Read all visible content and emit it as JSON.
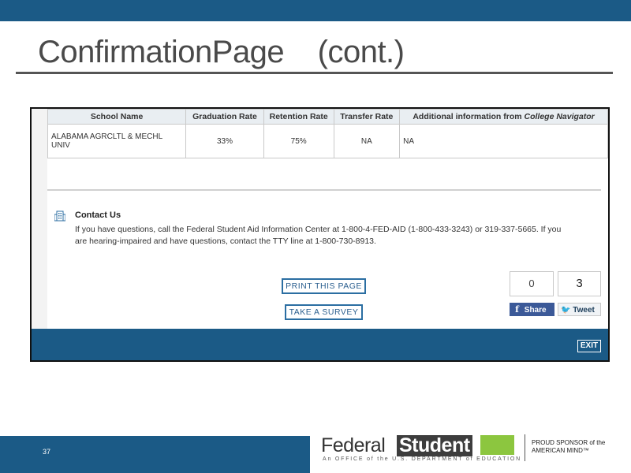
{
  "slide": {
    "title": "ConfirmationPage    (cont.)",
    "number": "37"
  },
  "table": {
    "headers": [
      "School Name",
      "Graduation Rate",
      "Retention Rate",
      "Transfer Rate",
      "Additional information from ",
      "College Navigator"
    ],
    "row": {
      "school_name": "ALABAMA AGRCLTL & MECHL UNIV",
      "graduation_rate": "33%",
      "retention_rate": "75%",
      "transfer_rate": "NA",
      "additional": "NA"
    }
  },
  "contact": {
    "title": "Contact Us",
    "text": "If you have questions, call the Federal Student Aid Information Center at 1-800-4-FED-AID (1-800-433-3243) or 319-337-5665. If you are hearing-impaired and have questions, contact the TTY line at 1-800-730-8913."
  },
  "buttons": {
    "print": "PRINT THIS PAGE",
    "survey": "TAKE A SURVEY",
    "exit": "EXIT"
  },
  "social": {
    "facebook_count": "0",
    "twitter_count": "3",
    "facebook_label": "Share",
    "twitter_label": "Tweet",
    "facebook_glyph": "f",
    "twitter_glyph": "🐦"
  },
  "logo": {
    "federal": "Federal",
    "student": "Student",
    "subtitle": "An OFFICE of the U.S. DEPARTMENT of EDUCATION",
    "proud": "PROUD SPONSOR of the AMERICAN MIND™"
  },
  "icons": [
    "building-icon",
    "facebook-icon",
    "twitter-icon"
  ],
  "colors": {
    "brand_blue": "#1b5a86",
    "accent_green": "#8cc63f",
    "facebook_blue": "#3b5998"
  }
}
